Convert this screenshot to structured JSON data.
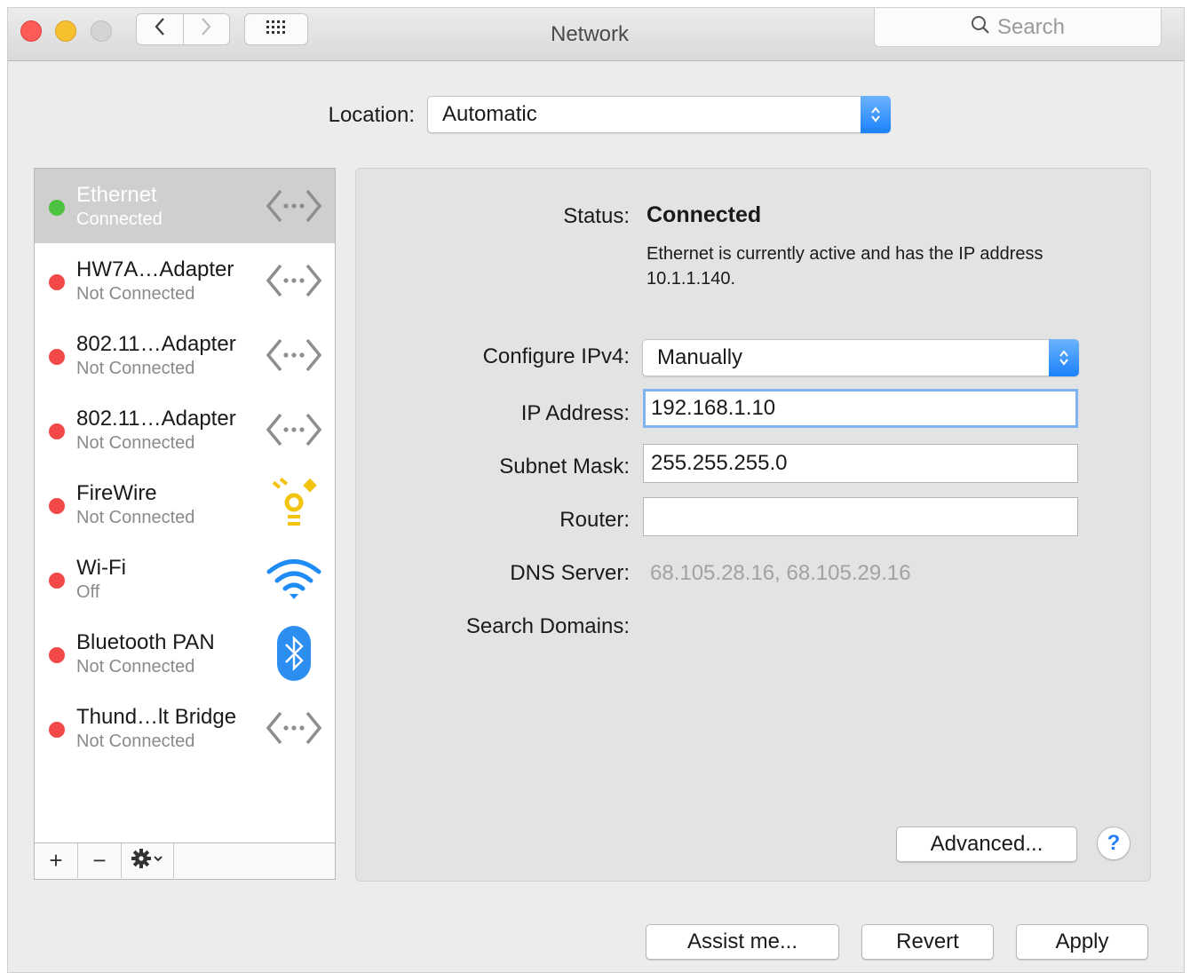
{
  "window": {
    "title": "Network"
  },
  "toolbar": {
    "back_icon": "chevron-left-icon",
    "forward_icon": "chevron-right-icon",
    "grid_icon": "show-all-grid-icon",
    "search_placeholder": "Search"
  },
  "location": {
    "label": "Location:",
    "value": "Automatic"
  },
  "services": [
    {
      "name": "Ethernet",
      "status": "Connected",
      "dot_color": "#4cc23f",
      "icon": "ethernet-icon",
      "selected": true
    },
    {
      "name": "HW7A…Adapter",
      "status": "Not Connected",
      "dot_color": "#f14848",
      "icon": "ethernet-icon"
    },
    {
      "name": "802.11…Adapter",
      "status": "Not Connected",
      "dot_color": "#f14848",
      "icon": "ethernet-icon"
    },
    {
      "name": "802.11…Adapter",
      "status": "Not Connected",
      "dot_color": "#f14848",
      "icon": "ethernet-icon"
    },
    {
      "name": "FireWire",
      "status": "Not Connected",
      "dot_color": "#f14848",
      "icon": "firewire-icon"
    },
    {
      "name": "Wi-Fi",
      "status": "Off",
      "dot_color": "#f14848",
      "icon": "wifi-icon"
    },
    {
      "name": "Bluetooth PAN",
      "status": "Not Connected",
      "dot_color": "#f14848",
      "icon": "bluetooth-icon"
    },
    {
      "name": "Thund…lt Bridge",
      "status": "Not Connected",
      "dot_color": "#f14848",
      "icon": "ethernet-icon"
    }
  ],
  "sidebar_actions": {
    "add": "+",
    "remove": "−"
  },
  "detail": {
    "status_label": "Status:",
    "status_value": "Connected",
    "status_description": "Ethernet is currently active and has the IP address 10.1.1.140.",
    "configure_label": "Configure IPv4:",
    "configure_value": "Manually",
    "ip_label": "IP Address:",
    "ip_value": "192.168.1.10",
    "subnet_label": "Subnet Mask:",
    "subnet_value": "255.255.255.0",
    "router_label": "Router:",
    "router_value": "",
    "dns_label": "DNS Server:",
    "dns_value": "68.105.28.16, 68.105.29.16",
    "search_domains_label": "Search Domains:",
    "advanced_label": "Advanced...",
    "help_label": "?"
  },
  "footer": {
    "assist_label": "Assist me...",
    "revert_label": "Revert",
    "apply_label": "Apply"
  },
  "colors": {
    "accent": "#1a82fb",
    "connected": "#4cc23f",
    "disconnected": "#f14848",
    "selection": "#cfcfcf"
  }
}
